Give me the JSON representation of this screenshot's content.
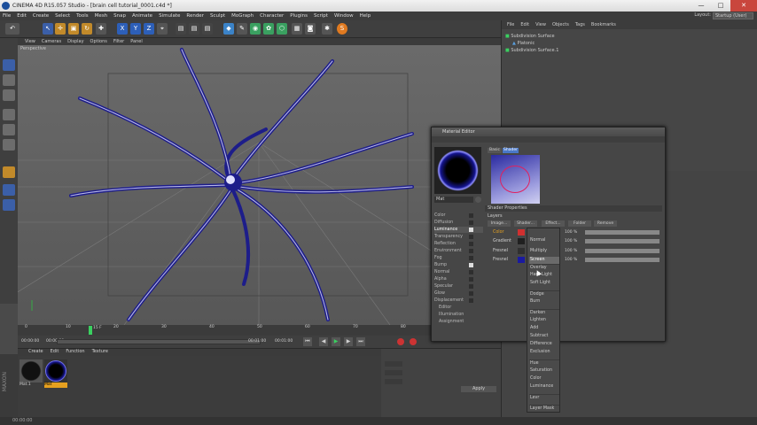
{
  "titlebar": {
    "title": "CINEMA 4D R15.057 Studio - [brain cell tutorial_0001.c4d *]",
    "min": "—",
    "max": "□",
    "close": "✕"
  },
  "menubar": {
    "items": [
      "File",
      "Edit",
      "Create",
      "Select",
      "Tools",
      "Mesh",
      "Snap",
      "Animate",
      "Simulate",
      "Render",
      "Sculpt",
      "MoGraph",
      "Character",
      "Plugins",
      "Script",
      "Window",
      "Help"
    ]
  },
  "layout": {
    "label": "Layout:",
    "value": "Startup (User)"
  },
  "viewport": {
    "menu": [
      "View",
      "Cameras",
      "Display",
      "Options",
      "Filter",
      "Panel"
    ],
    "label": "Perspective"
  },
  "timeline": {
    "ticks": [
      "0",
      "10",
      "20",
      "30",
      "40",
      "50",
      "60",
      "70",
      "80",
      "90"
    ],
    "frame": "15 F"
  },
  "playbar": {
    "start": "00:00:00",
    "cur": "00:00:00",
    "end": "00:01:00",
    "end2": "00:01:00"
  },
  "material_manager": {
    "menu": [
      "Create",
      "Edit",
      "Function",
      "Texture"
    ],
    "materials": [
      {
        "name": "Mat.1"
      },
      {
        "name": "Mat"
      }
    ]
  },
  "object_manager": {
    "menu": [
      "File",
      "Edit",
      "View",
      "Objects",
      "Tags",
      "Bookmarks"
    ],
    "objects": [
      {
        "name": "Subdivision Surface"
      },
      {
        "name": "Platonic"
      },
      {
        "name": "Subdivision Surface.1"
      }
    ]
  },
  "material_editor": {
    "title": "Material Editor",
    "mat_name": "Mat",
    "tabs": [
      "Basic",
      "Shader"
    ],
    "section": "Shader Properties",
    "layer_header": "Layers",
    "buttons": [
      "Image...",
      "Shader...",
      "Effect...",
      "Folder",
      "Remove"
    ],
    "channels": [
      {
        "name": "Color",
        "on": false
      },
      {
        "name": "Diffusion",
        "on": false
      },
      {
        "name": "Luminance",
        "on": true
      },
      {
        "name": "Transparency",
        "on": false
      },
      {
        "name": "Reflection",
        "on": false
      },
      {
        "name": "Environment",
        "on": false
      },
      {
        "name": "Fog",
        "on": false
      },
      {
        "name": "Bump",
        "on": true
      },
      {
        "name": "Normal",
        "on": false
      },
      {
        "name": "Alpha",
        "on": false
      },
      {
        "name": "Specular",
        "on": false
      },
      {
        "name": "Glow",
        "on": false
      },
      {
        "name": "Displacement",
        "on": false
      },
      {
        "name": "Editor",
        "on": null
      },
      {
        "name": "Illumination",
        "on": null
      },
      {
        "name": "Assignment",
        "on": null
      }
    ],
    "layers": [
      {
        "name": "Color",
        "mode": "Normal",
        "pct": "100 %",
        "color": "#d03030"
      },
      {
        "name": "Gradient",
        "mode": "Normal",
        "pct": "100 %",
        "color": "#202020"
      },
      {
        "name": "Fresnel",
        "mode": "Multiply",
        "pct": "100 %",
        "color": "#303030"
      },
      {
        "name": "Fresnel",
        "mode": "Screen",
        "pct": "100 %",
        "color": "#1a1aa0"
      }
    ]
  },
  "blend_dropdown": {
    "options": [
      "Normal",
      "Multiply",
      "Screen",
      "Overlay",
      "Hard Light",
      "Soft Light",
      "Dodge",
      "Burn",
      "Darken",
      "Lighten",
      "Add",
      "Subtract",
      "Difference",
      "Exclusion",
      "Hue",
      "Saturation",
      "Color",
      "Luminance",
      "Levr",
      "Layer Mask"
    ],
    "selected": "Screen"
  },
  "attributes": {
    "apply": "Apply"
  },
  "status": {
    "text": "00:00:00"
  },
  "colors": {
    "accent": "#4a78c8",
    "tentacle": "#2a2aa0",
    "selected_mat": "#e5a020"
  }
}
